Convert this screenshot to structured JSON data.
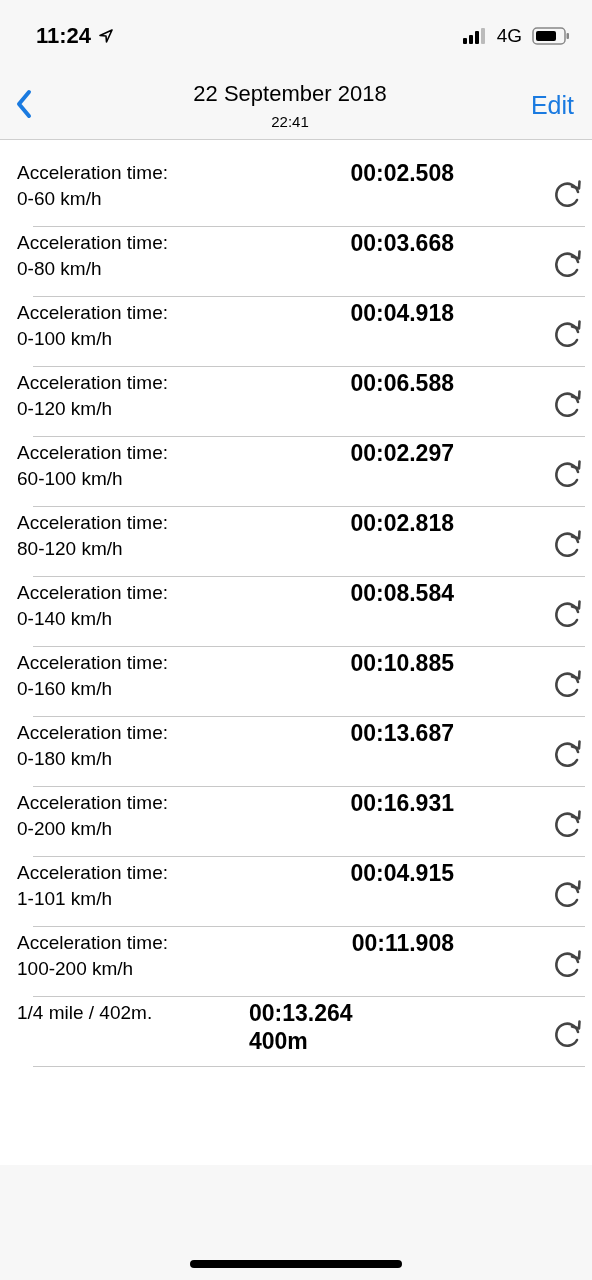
{
  "status_bar": {
    "time": "11:24",
    "network": "4G"
  },
  "nav": {
    "title": "22 September 2018",
    "subtitle": "22:41",
    "action": "Edit"
  },
  "results": [
    {
      "kind": "acceleration",
      "title": "Acceleration time:",
      "range": "0-60 km/h",
      "time": "00:02.508"
    },
    {
      "kind": "acceleration",
      "title": "Acceleration time:",
      "range": "0-80 km/h",
      "time": "00:03.668"
    },
    {
      "kind": "acceleration",
      "title": "Acceleration time:",
      "range": "0-100 km/h",
      "time": "00:04.918"
    },
    {
      "kind": "acceleration",
      "title": "Acceleration time:",
      "range": "0-120 km/h",
      "time": "00:06.588"
    },
    {
      "kind": "acceleration",
      "title": "Acceleration time:",
      "range": "60-100 km/h",
      "time": "00:02.297"
    },
    {
      "kind": "acceleration",
      "title": "Acceleration time:",
      "range": "80-120 km/h",
      "time": "00:02.818"
    },
    {
      "kind": "acceleration",
      "title": "Acceleration time:",
      "range": "0-140 km/h",
      "time": "00:08.584"
    },
    {
      "kind": "acceleration",
      "title": "Acceleration time:",
      "range": "0-160 km/h",
      "time": "00:10.885"
    },
    {
      "kind": "acceleration",
      "title": "Acceleration time:",
      "range": "0-180 km/h",
      "time": "00:13.687"
    },
    {
      "kind": "acceleration",
      "title": "Acceleration time:",
      "range": "0-200 km/h",
      "time": "00:16.931"
    },
    {
      "kind": "acceleration",
      "title": "Acceleration time:",
      "range": "1-101 km/h",
      "time": "00:04.915"
    },
    {
      "kind": "acceleration",
      "title": "Acceleration time:",
      "range": "100-200 km/h",
      "time": "00:11.908"
    },
    {
      "kind": "distance",
      "title": "1/4 mile / 402m.",
      "time": "00:13.264",
      "distance": "400m"
    }
  ]
}
